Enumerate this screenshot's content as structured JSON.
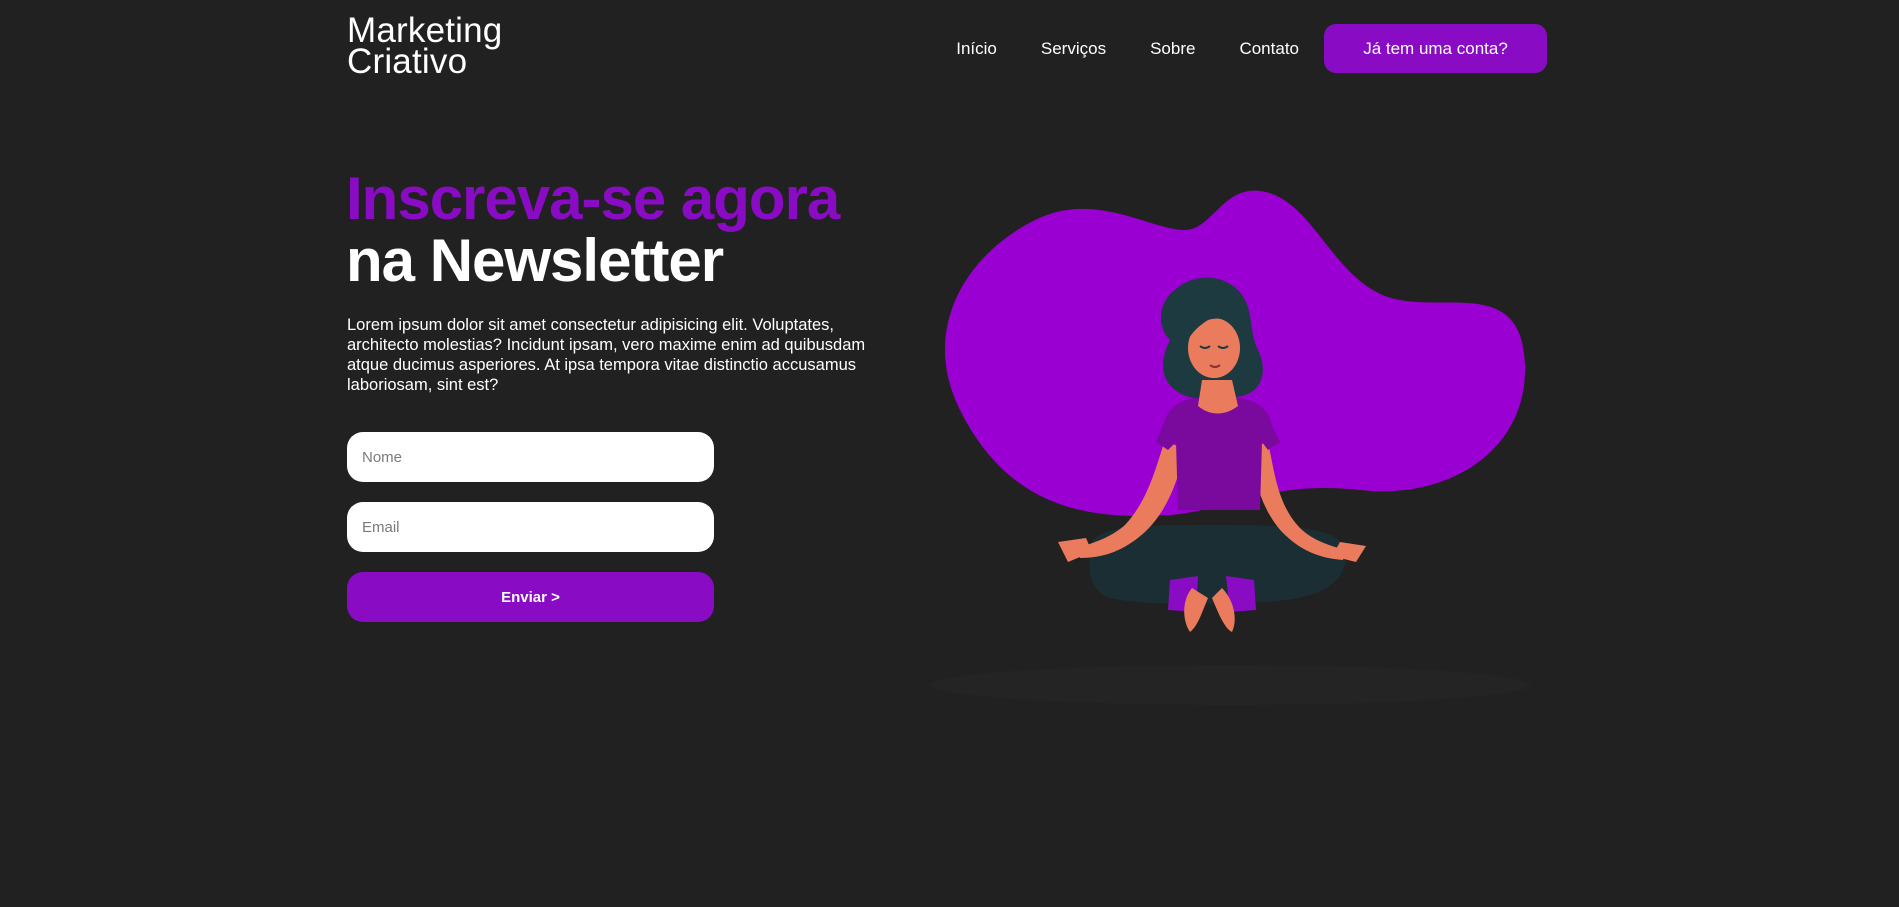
{
  "header": {
    "logo_line1": "Marketing",
    "logo_line2": "Criativo",
    "nav": [
      "Início",
      "Serviços",
      "Sobre",
      "Contato"
    ],
    "account_button": "Já tem uma conta?"
  },
  "hero": {
    "title_line1": "Inscreva-se agora",
    "title_line2": "na Newsletter",
    "description": "Lorem ipsum dolor sit amet consectetur adipisicing elit. Voluptates, architecto molestias? Incidunt ipsam, vero maxime enim ad quibusdam atque ducimus asperiores. At ipsa tempora vitae distinctio accusamus laboriosam, sint est?"
  },
  "form": {
    "name_placeholder": "Nome",
    "email_placeholder": "Email",
    "submit_label": "Enviar >"
  },
  "colors": {
    "background": "#212121",
    "accent": "#8a0bc4",
    "blob": "#9b00d3",
    "skin": "#ea7c5d",
    "hair": "#1d3a40",
    "pants": "#1a2e33"
  },
  "illustration": {
    "icon": "meditating-woman-illustration"
  }
}
